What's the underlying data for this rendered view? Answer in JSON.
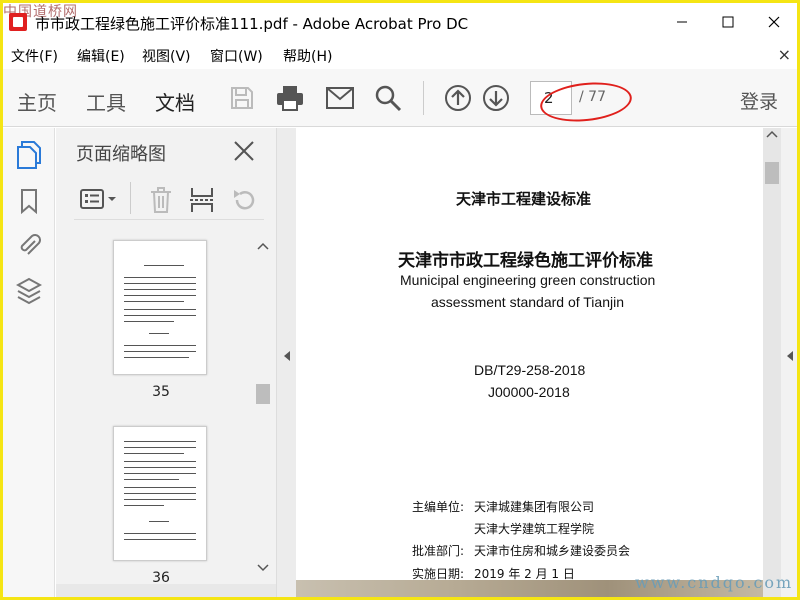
{
  "window": {
    "title": "市市政工程绿色施工评价标准111.pdf - Adobe Acrobat Pro DC",
    "watermark_top": "中国道桥网",
    "watermark_bottom": "www.cndqo.com"
  },
  "menu": [
    "文件(F)",
    "编辑(E)",
    "视图(V)",
    "窗口(W)",
    "帮助(H)"
  ],
  "menu_close": "×",
  "toolbar": {
    "tabs": [
      "主页",
      "工具",
      "文档"
    ],
    "active_tab": "文档",
    "page_current": "2",
    "page_total": "/ 77",
    "login": "登录",
    "icons": [
      "save-icon",
      "print-icon",
      "email-icon",
      "search-icon",
      "prev-page-icon",
      "next-page-icon"
    ]
  },
  "rail_icons": [
    "pages-icon",
    "bookmark-icon",
    "attachment-icon",
    "layers-icon"
  ],
  "thumbnail_panel": {
    "title": "页面缩略图",
    "pages": [
      "35",
      "36"
    ]
  },
  "document": {
    "header": "天津市工程建设标准",
    "title_cn": "天津市市政工程绿色施工评价标准",
    "title_en_1": "Municipal engineering green construction",
    "title_en_2": "assessment standard of Tianjin",
    "code_1": "DB/T29-258-2018",
    "code_2": "J00000-2018",
    "editor_label": "主编单位:",
    "editor_1": "天津城建集团有限公司",
    "editor_2": "天津大学建筑工程学院",
    "approver_label": "批准部门:",
    "approver": "天津市住房和城乡建设委员会",
    "date_label": "实施日期:",
    "date": "2019 年 2 月 1 日"
  },
  "colors": {
    "frame": "#f5e514",
    "callout": "#e0201c",
    "acrobat_red": "#e02020"
  }
}
